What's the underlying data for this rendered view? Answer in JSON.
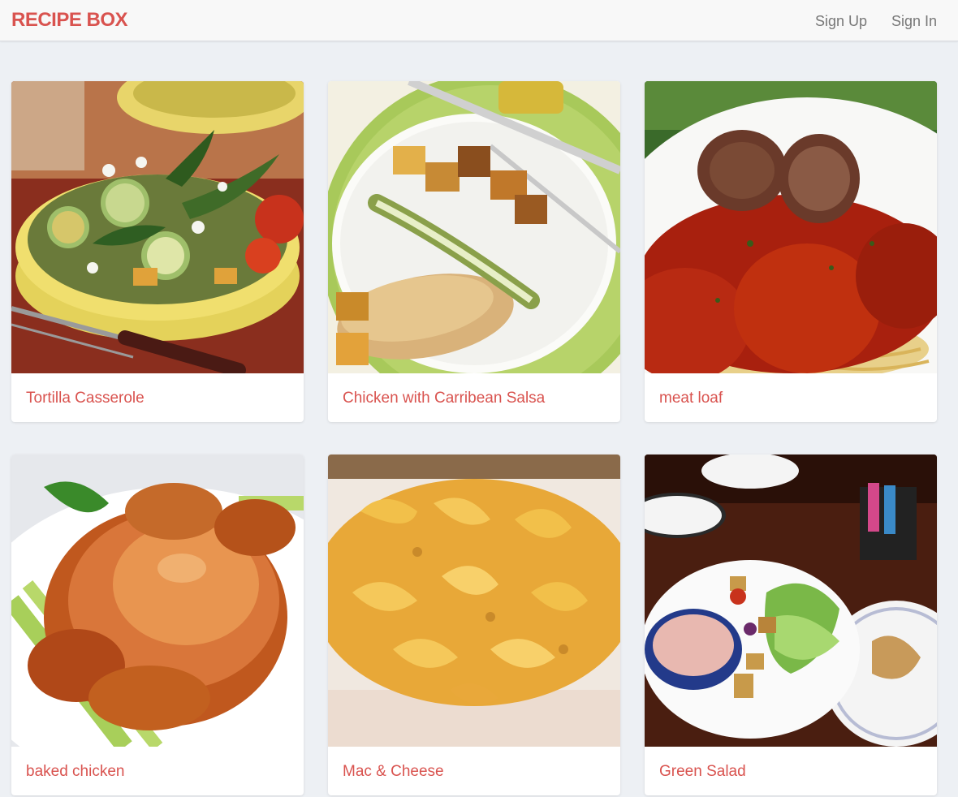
{
  "navbar": {
    "brand": "RECIPE BOX",
    "links": [
      {
        "label": "Sign Up"
      },
      {
        "label": "Sign In"
      }
    ]
  },
  "colors": {
    "accent": "#d9534f",
    "background": "#edf0f4",
    "navbar_bg": "#f8f8f8",
    "nav_link": "#777777",
    "card_bg": "#ffffff"
  },
  "recipes": [
    {
      "title": "Tortilla Casserole",
      "image": "vegetable-casserole-photo"
    },
    {
      "title": "Chicken with Carribean Salsa",
      "image": "chicken-breast-plate-photo"
    },
    {
      "title": "meat loaf",
      "image": "meatballs-spaghetti-photo"
    },
    {
      "title": "baked chicken",
      "image": "roast-chicken-photo"
    },
    {
      "title": "Mac & Cheese",
      "image": "mac-and-cheese-photo"
    },
    {
      "title": "Green Salad",
      "image": "green-salad-table-photo"
    }
  ]
}
